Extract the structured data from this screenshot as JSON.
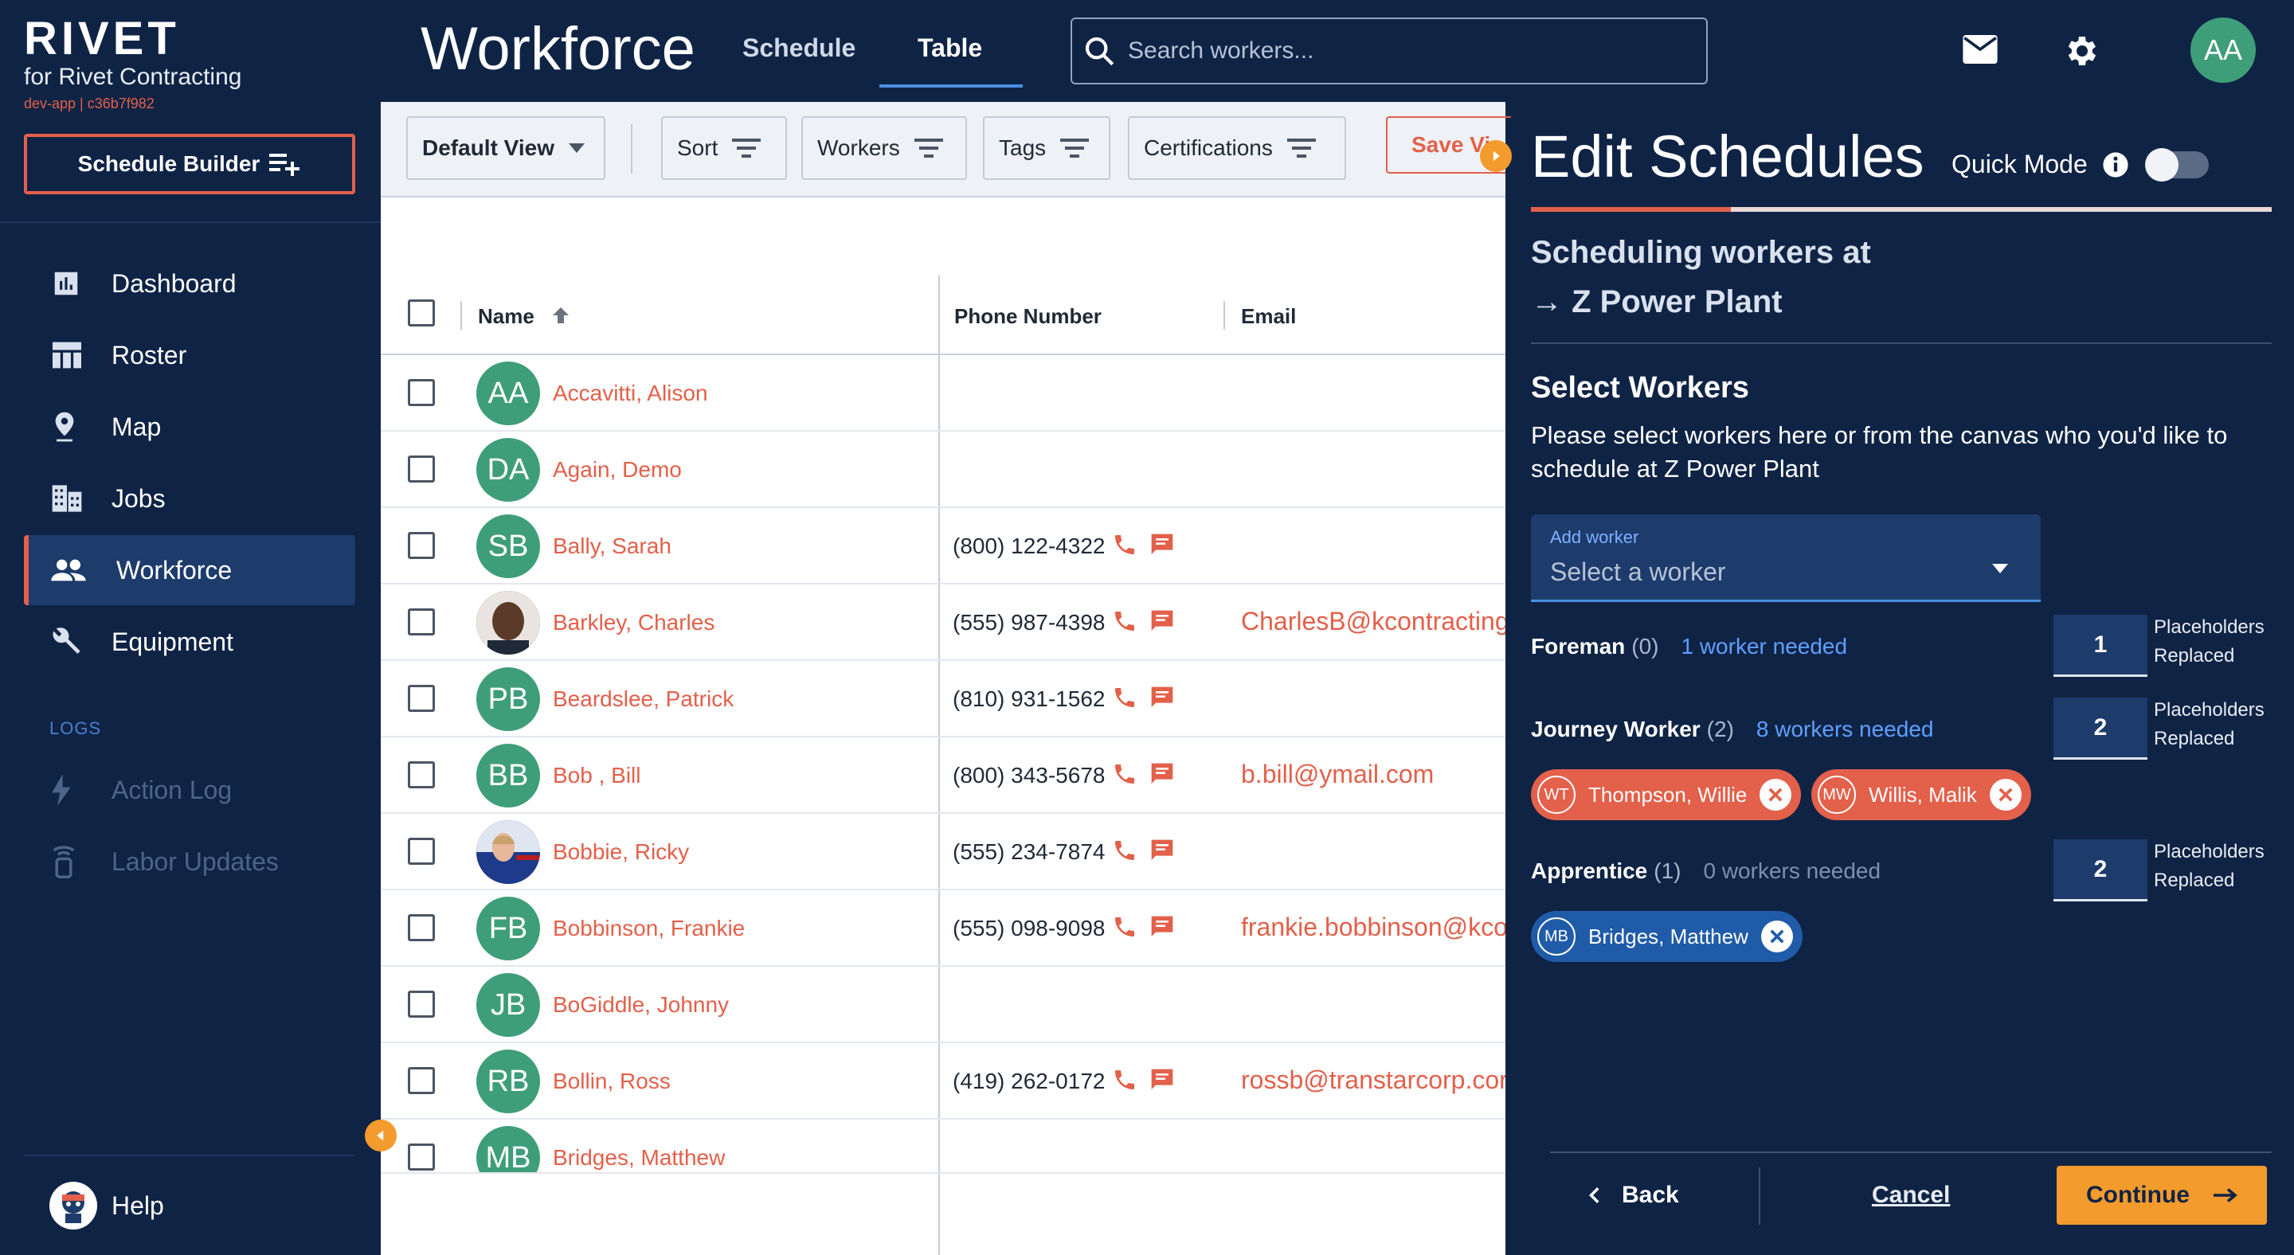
{
  "brand": {
    "logo": "RIVET",
    "company": "for Rivet Contracting",
    "env": "dev-app | c36b7f982"
  },
  "sidebar": {
    "schedule_builder": "Schedule Builder",
    "items": [
      {
        "label": "Dashboard",
        "icon": "bar-chart-icon"
      },
      {
        "label": "Roster",
        "icon": "table-icon"
      },
      {
        "label": "Map",
        "icon": "map-pin-icon"
      },
      {
        "label": "Jobs",
        "icon": "building-icon"
      },
      {
        "label": "Workforce",
        "icon": "people-icon",
        "active": true
      },
      {
        "label": "Equipment",
        "icon": "wrench-icon"
      }
    ],
    "logs_label": "LOGS",
    "log_items": [
      {
        "label": "Action Log",
        "icon": "bolt-icon"
      },
      {
        "label": "Labor Updates",
        "icon": "radio-icon"
      }
    ],
    "help": "Help"
  },
  "header": {
    "title": "Workforce",
    "tabs": [
      "Schedule",
      "Table"
    ],
    "active_tab": "Table",
    "search_placeholder": "Search workers...",
    "user_initials": "AA"
  },
  "toolbar": {
    "default_view": "Default View",
    "sort": "Sort",
    "workers": "Workers",
    "tags": "Tags",
    "certifications": "Certifications",
    "save_view": "Save Vi"
  },
  "table": {
    "columns": [
      "Name",
      "Phone Number",
      "Email"
    ],
    "rows": [
      {
        "initials": "AA",
        "name": "Accavitti, Alison",
        "phone": "",
        "email": ""
      },
      {
        "initials": "DA",
        "name": "Again, Demo",
        "phone": "",
        "email": ""
      },
      {
        "initials": "SB",
        "name": "Bally, Sarah",
        "phone": "(800) 122-4322",
        "email": ""
      },
      {
        "initials": "",
        "name": "Barkley, Charles",
        "phone": "(555) 987-4398",
        "email": "CharlesB@kcontracting",
        "photo": true
      },
      {
        "initials": "PB",
        "name": "Beardslee, Patrick",
        "phone": "(810) 931-1562",
        "email": ""
      },
      {
        "initials": "BB",
        "name": "Bob , Bill",
        "phone": "(800) 343-5678",
        "email": "b.bill@ymail.com"
      },
      {
        "initials": "",
        "name": "Bobbie, Ricky",
        "phone": "(555) 234-7874",
        "email": "",
        "photo": true
      },
      {
        "initials": "FB",
        "name": "Bobbinson, Frankie",
        "phone": "(555) 098-9098",
        "email": "frankie.bobbinson@kco"
      },
      {
        "initials": "JB",
        "name": "BoGiddle, Johnny",
        "phone": "",
        "email": ""
      },
      {
        "initials": "RB",
        "name": "Bollin, Ross",
        "phone": "(419) 262-0172",
        "email": "rossb@transtarcorp.cor"
      },
      {
        "initials": "MB",
        "name": "Bridges, Matthew",
        "phone": "",
        "email": ""
      }
    ]
  },
  "panel": {
    "title": "Edit Schedules",
    "quick_mode": "Quick Mode",
    "progress": 0.27,
    "sched_line1": "Scheduling workers at",
    "sched_line2": "→ Z Power Plant",
    "select_title": "Select Workers",
    "select_desc": "Please select workers here or from the canvas who you'd like to schedule at Z Power Plant",
    "add_worker_label": "Add worker",
    "add_worker_placeholder": "Select a worker",
    "roles": [
      {
        "name": "Foreman",
        "count": "(0)",
        "needed": "1 worker needed",
        "placeholders": "1"
      },
      {
        "name": "Journey Worker",
        "count": "(2)",
        "needed": "8 workers needed",
        "placeholders": "2"
      },
      {
        "name": "Apprentice",
        "count": "(1)",
        "needed": "0 workers needed",
        "placeholders": "2"
      }
    ],
    "placeholders_line1": "Placeholders",
    "placeholders_line2": "Replaced",
    "chips": {
      "journey": [
        {
          "initials": "WT",
          "name": "Thompson, Willie"
        },
        {
          "initials": "MW",
          "name": "Willis, Malik"
        }
      ],
      "apprentice": [
        {
          "initials": "MB",
          "name": "Bridges, Matthew"
        }
      ]
    },
    "back": "Back",
    "cancel": "Cancel",
    "continue": "Continue"
  }
}
